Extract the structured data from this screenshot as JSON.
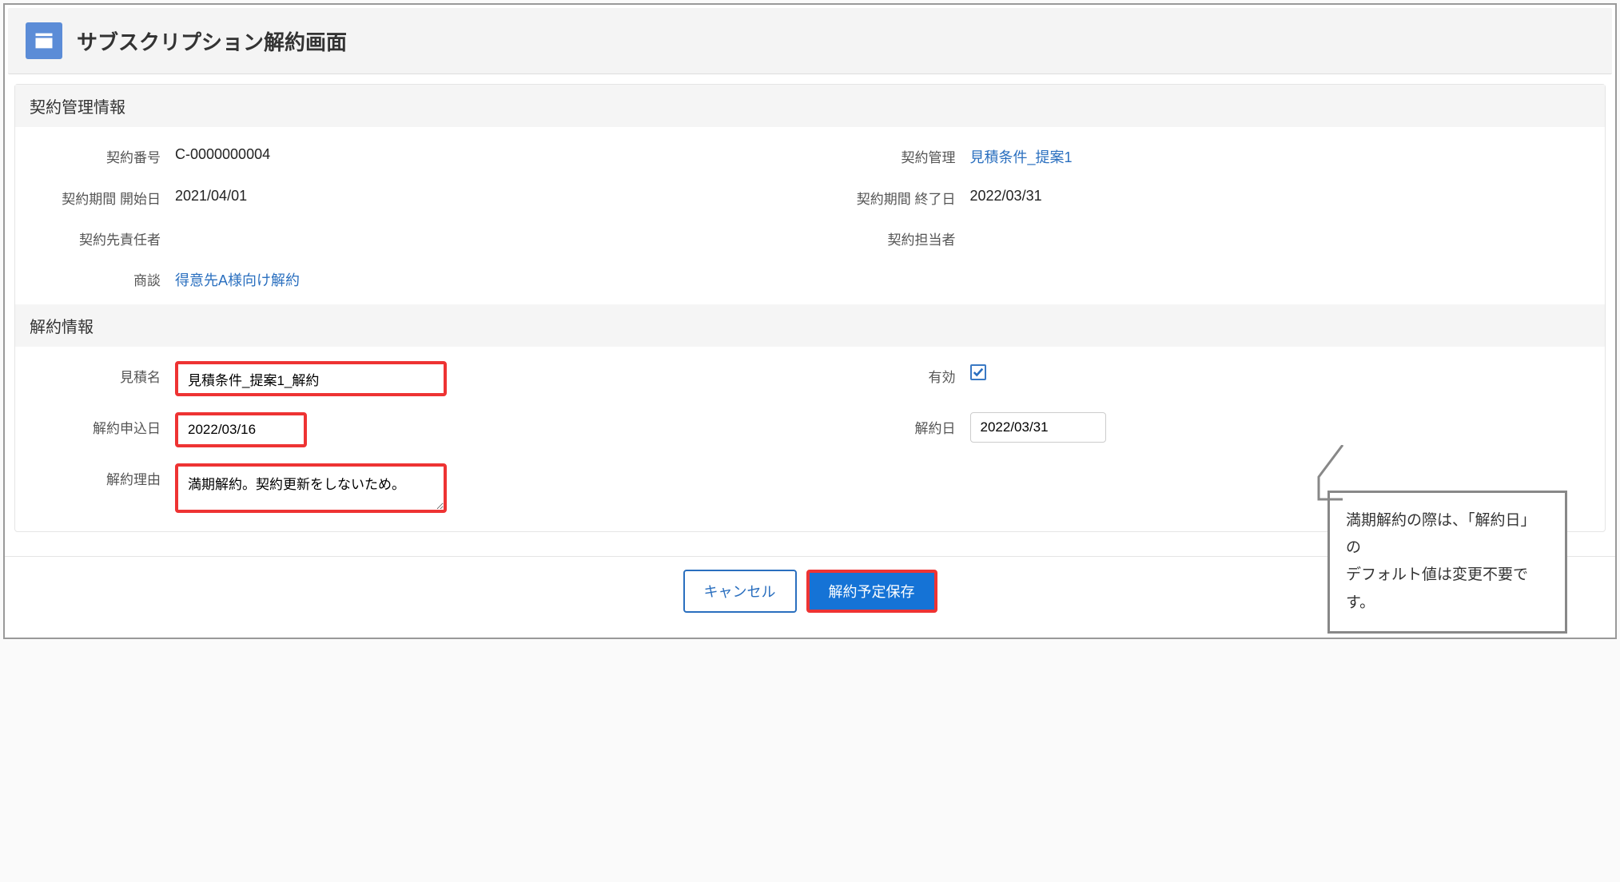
{
  "page_title": "サブスクリプション解約画面",
  "sections": {
    "contract_info": {
      "heading": "契約管理情報",
      "fields": {
        "contract_number": {
          "label": "契約番号",
          "value": "C-0000000004"
        },
        "contract_mgmt": {
          "label": "契約管理",
          "value": "見積条件_提案1"
        },
        "period_start": {
          "label": "契約期間 開始日",
          "value": "2021/04/01"
        },
        "period_end": {
          "label": "契約期間 終了日",
          "value": "2022/03/31"
        },
        "client_manager": {
          "label": "契約先責任者",
          "value": ""
        },
        "contract_rep": {
          "label": "契約担当者",
          "value": ""
        },
        "opportunity": {
          "label": "商談",
          "value": "得意先A様向け解約"
        }
      }
    },
    "cancel_info": {
      "heading": "解約情報",
      "fields": {
        "quote_name": {
          "label": "見積名",
          "value": "見積条件_提案1_解約"
        },
        "active": {
          "label": "有効",
          "checked": true
        },
        "cancel_apply": {
          "label": "解約申込日",
          "value": "2022/03/16"
        },
        "cancel_date": {
          "label": "解約日",
          "value": "2022/03/31"
        },
        "cancel_reason": {
          "label": "解約理由",
          "value": "満期解約。契約更新をしないため。"
        }
      }
    }
  },
  "buttons": {
    "cancel": "キャンセル",
    "save": "解約予定保存"
  },
  "callout": {
    "line1": "満期解約の際は、「解約日」の",
    "line2": "デフォルト値は変更不要です。"
  }
}
